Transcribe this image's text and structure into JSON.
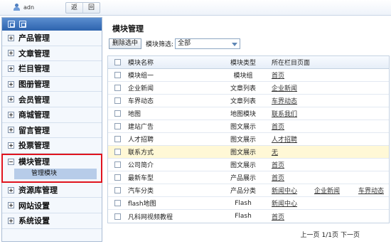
{
  "topbar": {
    "username": "adn",
    "back_label": "返",
    "forward_label": "回"
  },
  "sidebar": {
    "items": [
      {
        "label": "产品管理"
      },
      {
        "label": "文章管理"
      },
      {
        "label": "栏目管理"
      },
      {
        "label": "图册管理"
      },
      {
        "label": "会员管理"
      },
      {
        "label": "商城管理"
      },
      {
        "label": "留言管理"
      },
      {
        "label": "投票管理"
      }
    ],
    "active_group": {
      "label": "模块管理",
      "sub_label": "管理模块"
    },
    "items_after": [
      {
        "label": "资源库管理"
      },
      {
        "label": "网站设置"
      },
      {
        "label": "系统设置"
      }
    ]
  },
  "main": {
    "title": "模块管理",
    "delete_label": "删除选中",
    "filter_label": "模块筛选:",
    "filter_value": "全部",
    "columns": {
      "name": "模块名称",
      "type": "模块类型",
      "pages": "所在栏目页面"
    },
    "rows": [
      {
        "name": "模块组一",
        "type": "模块组",
        "pages": [
          "首页"
        ]
      },
      {
        "name": "企业新闻",
        "type": "文章列表",
        "pages": [
          "企业新闻"
        ]
      },
      {
        "name": "车界动态",
        "type": "文章列表",
        "pages": [
          "车界动态"
        ]
      },
      {
        "name": "地图",
        "type": "地图模块",
        "pages": [
          "联系我们"
        ]
      },
      {
        "name": "建站广告",
        "type": "图文展示",
        "pages": [
          "首页"
        ]
      },
      {
        "name": "人才招聘",
        "type": "图文展示",
        "pages": [
          "人才招聘"
        ]
      },
      {
        "name": "联系方式",
        "type": "图文展示",
        "pages": [
          "无"
        ]
      },
      {
        "name": "公司简介",
        "type": "图文展示",
        "pages": [
          "首页"
        ]
      },
      {
        "name": "最新车型",
        "type": "产品展示",
        "pages": [
          "首页"
        ]
      },
      {
        "name": "汽车分类",
        "type": "产品分类",
        "pages": [
          "新闻中心",
          "企业新闻",
          "车界动态"
        ]
      },
      {
        "name": "flash地图",
        "type": "Flash",
        "pages": [
          "新闻中心"
        ]
      },
      {
        "name": "凡科网视频教程",
        "type": "Flash",
        "pages": [
          "首页"
        ]
      }
    ],
    "pager": {
      "prev": "上一页",
      "page_info": "1/1页",
      "next": "下一页"
    }
  }
}
